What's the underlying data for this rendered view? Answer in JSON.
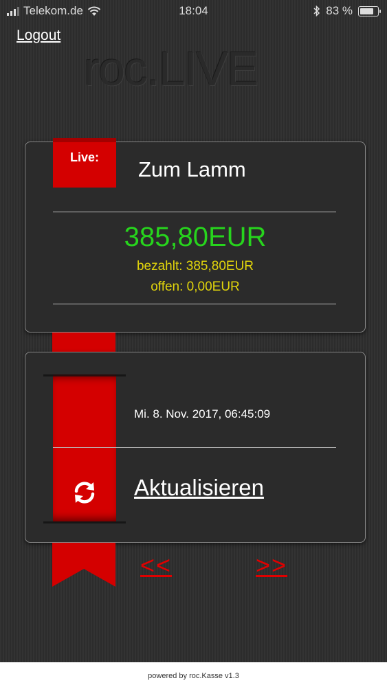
{
  "status_bar": {
    "carrier": "Telekom.de",
    "time": "18:04",
    "battery": "83 %",
    "battery_level": 0.83
  },
  "logout_label": "Logout",
  "logo_text": "roc.LIVE",
  "live_card": {
    "badge": "Live:",
    "title": "Zum Lamm",
    "amount": "385,80EUR",
    "paid": "bezahlt: 385,80EUR",
    "open": "offen: 0,00EUR"
  },
  "update_card": {
    "timestamp": "Mi. 8. Nov. 2017, 06:45:09",
    "refresh_label": "Aktualisieren"
  },
  "nav": {
    "prev_label": "<<",
    "next_label": ">>"
  },
  "footer": {
    "text": "powered by roc.Kasse v1.3"
  },
  "colors": {
    "accent_red": "#d40000",
    "amount_green": "#27d41d",
    "paid_yellow": "#e2d50b"
  }
}
